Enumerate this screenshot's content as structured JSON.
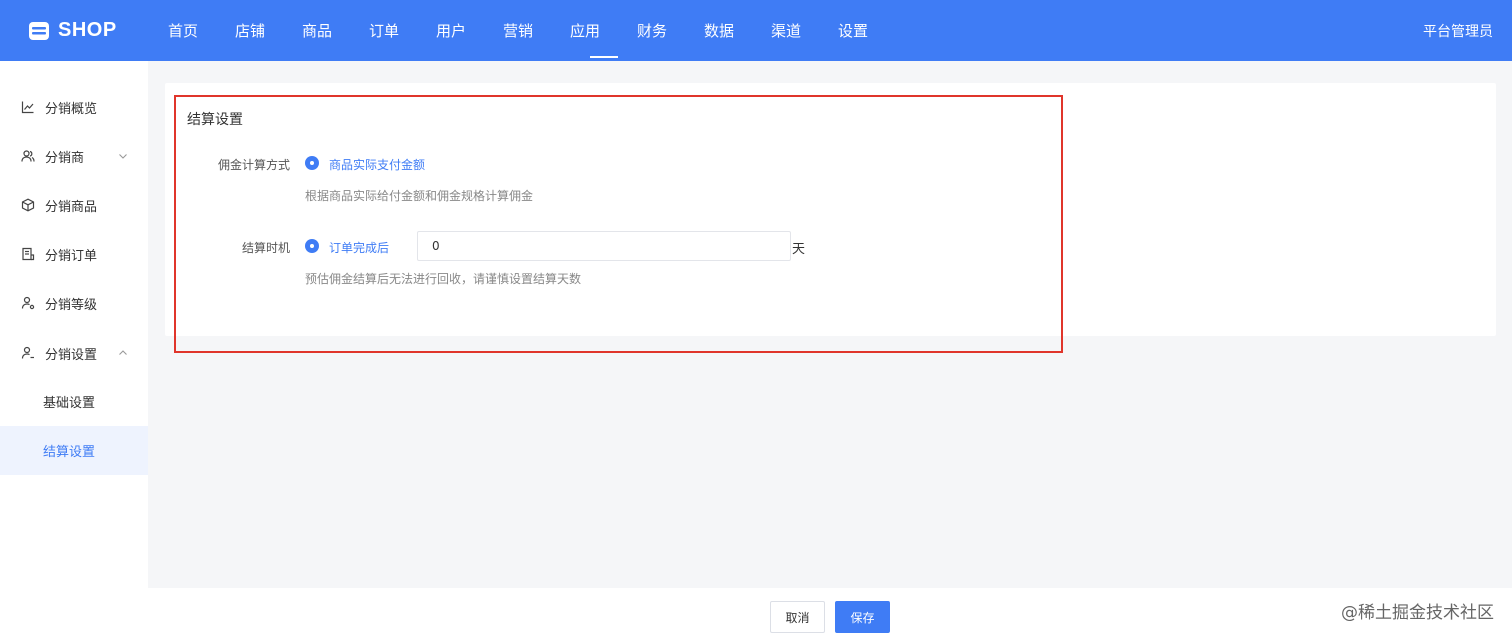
{
  "header": {
    "brand": "SHOP",
    "nav": [
      "首页",
      "店铺",
      "商品",
      "订单",
      "用户",
      "营销",
      "应用",
      "财务",
      "数据",
      "渠道",
      "设置"
    ],
    "active_nav": "应用",
    "user": "平台管理员"
  },
  "sidebar": {
    "items": [
      {
        "label": "分销概览",
        "icon": "line-chart-icon"
      },
      {
        "label": "分销商",
        "icon": "users-icon",
        "expand": "chevron-down"
      },
      {
        "label": "分销商品",
        "icon": "box-icon"
      },
      {
        "label": "分销订单",
        "icon": "order-icon"
      },
      {
        "label": "分销等级",
        "icon": "user-level-icon"
      },
      {
        "label": "分销设置",
        "icon": "user-settings-icon",
        "expand": "chevron-up"
      }
    ],
    "sub_items": [
      {
        "label": "基础设置",
        "active": false
      },
      {
        "label": "结算设置",
        "active": true
      }
    ]
  },
  "settings": {
    "title": "结算设置",
    "commission_method": {
      "label": "佣金计算方式",
      "option": "商品实际支付金额",
      "hint": "根据商品实际给付金额和佣金规格计算佣金"
    },
    "settlement_time": {
      "label": "结算时机",
      "option": "订单完成后",
      "value": "0",
      "unit": "天",
      "hint": "预估佣金结算后无法进行回收，请谨慎设置结算天数"
    }
  },
  "footer": {
    "cancel": "取消",
    "save": "保存"
  },
  "watermark": "@稀土掘金技术社区",
  "colors": {
    "primary": "#3f7cf5",
    "highlight_border": "#e0352b"
  }
}
